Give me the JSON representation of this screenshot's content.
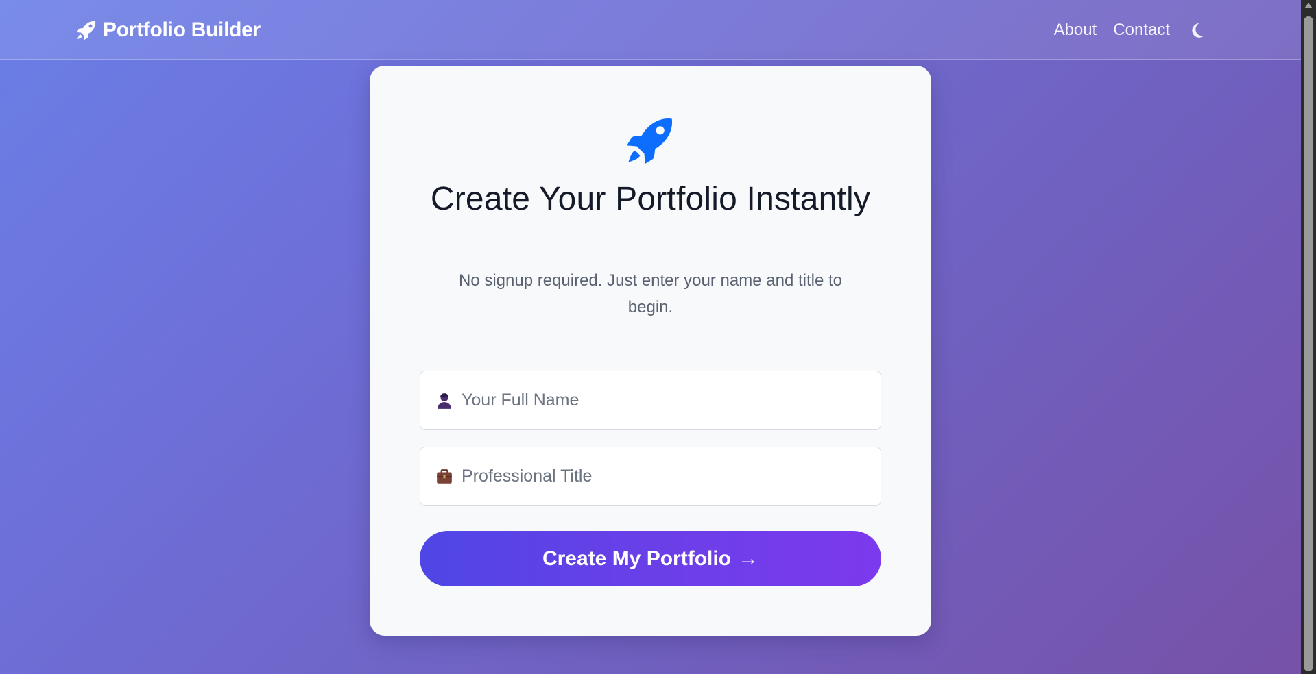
{
  "navbar": {
    "brand": "Portfolio Builder",
    "brand_icon": "rocket-icon",
    "links": {
      "about": "About",
      "contact": "Contact"
    },
    "theme_toggle_icon": "moon-icon"
  },
  "card": {
    "hero_icon": "rocket-icon",
    "title": "Create Your Portfolio Instantly",
    "subtitle": "No signup required. Just enter your name and title to begin.",
    "fields": {
      "name": {
        "icon": "person-icon",
        "placeholder": "Your Full Name",
        "value": ""
      },
      "title": {
        "icon": "briefcase-icon",
        "placeholder": "Professional Title",
        "value": ""
      }
    },
    "submit": {
      "label": "Create My Portfolio",
      "arrow": "→"
    }
  },
  "colors": {
    "accent_blue": "#0d6efd",
    "button_gradient_start": "#4f46e5",
    "button_gradient_end": "#7c3aed",
    "background_start": "#6a7fe6",
    "background_end": "#7751a7"
  }
}
